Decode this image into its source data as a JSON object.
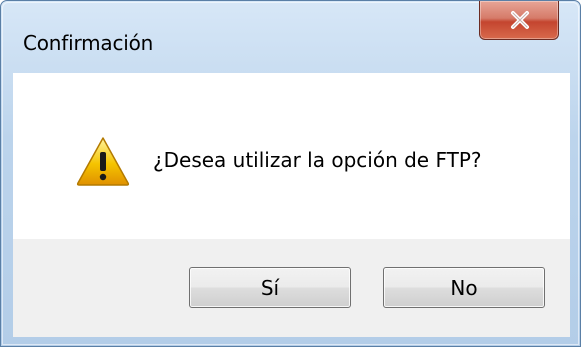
{
  "window": {
    "title": "Confirmación"
  },
  "dialog": {
    "message": "¿Desea utilizar la opción de FTP?",
    "icon": "warning-icon"
  },
  "buttons": {
    "yes_label": "Sí",
    "no_label": "No"
  },
  "titlebar": {
    "close_icon": "close-icon"
  },
  "colors": {
    "close_button": "#c4452f",
    "frame": "#b3cde8",
    "footer": "#f0f0f0",
    "warning": "#f5c400"
  }
}
